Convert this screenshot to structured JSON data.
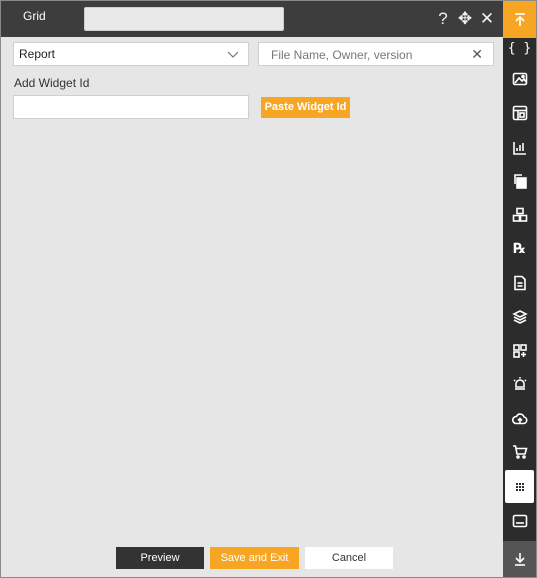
{
  "window": {
    "title": "Grid",
    "title_input_value": ""
  },
  "toolbar": {
    "help_icon": "?",
    "move_icon": "✥",
    "close_icon": "✕"
  },
  "filters": {
    "report_select": {
      "selected": "Report"
    },
    "search": {
      "placeholder": "File Name, Owner, version",
      "value": ""
    }
  },
  "widget": {
    "label": "Add Widget Id",
    "input_value": "",
    "paste_label": "Paste Widget Id"
  },
  "footer": {
    "preview_label": "Preview",
    "save_exit_label": "Save and Exit",
    "cancel_label": "Cancel"
  },
  "rail": {
    "items": [
      {
        "name": "scroll-top",
        "icon": "arrow-up-to-line-icon"
      },
      {
        "name": "code",
        "icon": "curly-braces-icon"
      },
      {
        "name": "image",
        "icon": "image-icon"
      },
      {
        "name": "layout",
        "icon": "layout-icon"
      },
      {
        "name": "chart",
        "icon": "bar-chart-icon"
      },
      {
        "name": "copy",
        "icon": "copy-icon"
      },
      {
        "name": "cubes",
        "icon": "cubes-icon"
      },
      {
        "name": "rx",
        "icon": "rx-icon"
      },
      {
        "name": "document",
        "icon": "document-icon"
      },
      {
        "name": "layers",
        "icon": "layers-icon"
      },
      {
        "name": "add-grid",
        "icon": "add-grid-icon"
      },
      {
        "name": "alarm",
        "icon": "alarm-icon"
      },
      {
        "name": "cloud-upload",
        "icon": "cloud-upload-icon"
      },
      {
        "name": "cart",
        "icon": "cart-icon"
      },
      {
        "name": "grid",
        "icon": "grid-dots-icon",
        "active": true
      },
      {
        "name": "subtitles",
        "icon": "subtitles-icon"
      },
      {
        "name": "scroll-bottom",
        "icon": "arrow-down-to-line-icon"
      }
    ],
    "accent": "#f6a623",
    "background": "#2c2c2c"
  },
  "colors": {
    "titlebar": "#3d3d3d",
    "panel": "#e6e6e6",
    "accent": "#f6a623"
  }
}
